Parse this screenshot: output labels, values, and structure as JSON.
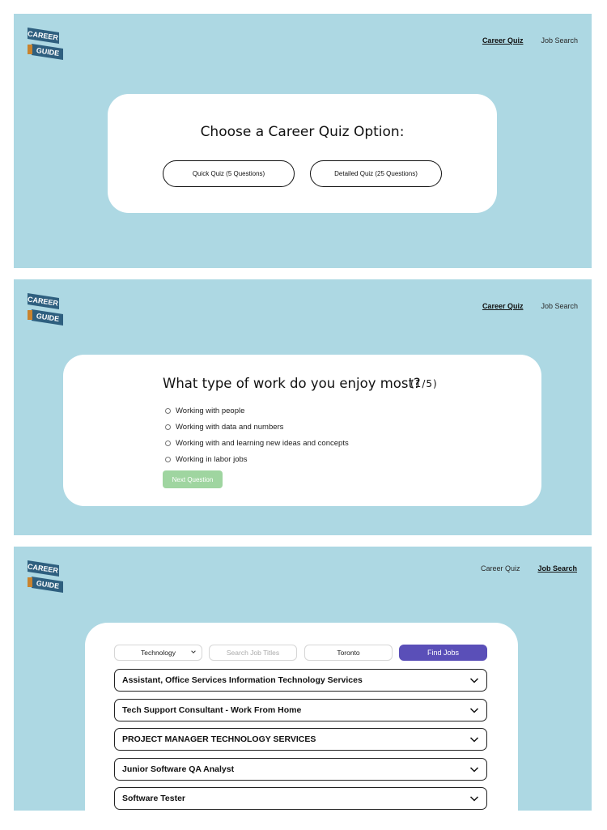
{
  "logo": {
    "line1": "CAREER",
    "line2": "GUIDE"
  },
  "nav": {
    "career_quiz": "Career Quiz",
    "job_search": "Job Search"
  },
  "quiz_select": {
    "title": "Choose a Career Quiz Option:",
    "quick_label": "Quick Quiz (5 Questions)",
    "detailed_label": "Detailed Quiz (25 Questions)"
  },
  "question": {
    "title": "What type of work do you enjoy most?",
    "progress": "(1/5)",
    "options": [
      "Working with people",
      "Working with data and numbers",
      "Working with and learning new ideas and concepts",
      "Working in labor jobs"
    ],
    "next_label": "Next Question"
  },
  "job_search": {
    "category": "Technology",
    "search_placeholder": "Search Job Titles",
    "location": "Toronto",
    "find_label": "Find Jobs",
    "results": [
      "Assistant, Office Services Information Technology Services",
      "Tech Support Consultant - Work From Home",
      "PROJECT MANAGER TECHNOLOGY SERVICES",
      "Junior Software QA Analyst",
      "Software Tester"
    ]
  },
  "colors": {
    "background": "#add8e3",
    "find_button": "#5a4fb8",
    "next_button": "#9fd5a0",
    "logo": "#2e5f7f"
  },
  "icons": [
    "chevron-down-icon",
    "radio-icon"
  ]
}
